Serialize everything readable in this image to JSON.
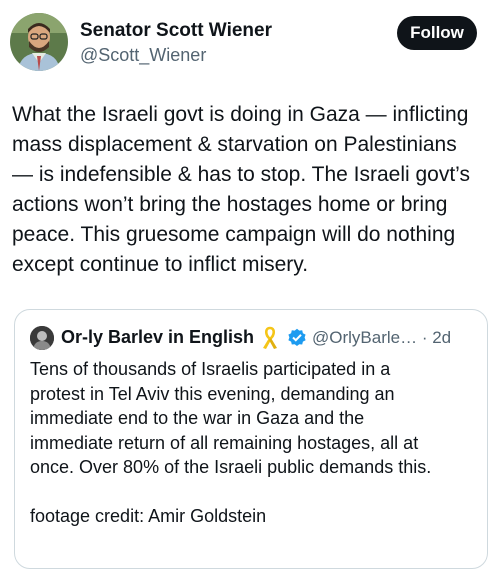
{
  "author": {
    "name": "Senator Scott Wiener",
    "handle": "@Scott_Wiener"
  },
  "follow_label": "Follow",
  "tweet_lines": [
    "What the Israeli govt is doing in Gaza — inflicting",
    "mass displacement & starvation on Palestinians",
    "— is indefensible & has to stop. The Israeli govt’s",
    "actions won’t bring the hostages home or bring",
    "peace. This gruesome campaign will do nothing",
    "except continue to inflict misery."
  ],
  "quote": {
    "name": "Or-ly Barlev in English",
    "handle_time": "@OrlyBarle… · 2d",
    "badges": [
      "yellow-ribbon-icon",
      "verified-badge-icon"
    ],
    "lines": [
      "Tens of thousands of Israelis participated in a",
      "protest in Tel Aviv this evening, demanding an",
      "immediate end to the war in Gaza and the",
      "immediate return of all remaining hostages, all at",
      "once. Over 80% of the Israeli public demands this."
    ],
    "credit": "footage credit: Amir Goldstein"
  },
  "colors": {
    "text": "#0f1419",
    "secondary": "#536471",
    "border": "#cfd9de",
    "follow_bg": "#0f1419",
    "verified": "#1d9bf0",
    "ribbon": "#f5c518"
  }
}
